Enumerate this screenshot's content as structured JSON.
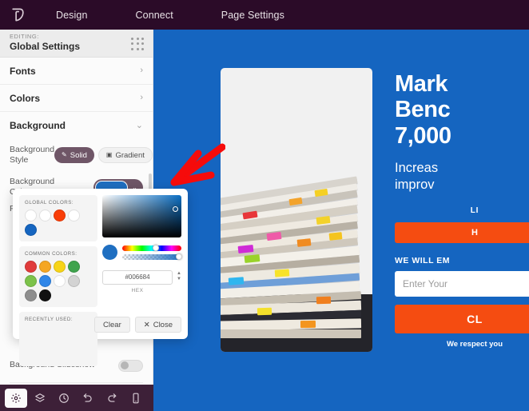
{
  "topbar": {
    "logo_icon": "leaf-logo-icon",
    "nav": [
      {
        "label": "Design",
        "name": "nav-design"
      },
      {
        "label": "Connect",
        "name": "nav-connect"
      },
      {
        "label": "Page Settings",
        "name": "nav-page-settings"
      }
    ],
    "bg_color": "#2b0b28"
  },
  "sidebar": {
    "editing_label": "EDITING:",
    "editing_title": "Global Settings",
    "drag_handle_icon": "grid-dots-icon",
    "sections": [
      {
        "label": "Fonts",
        "name": "section-fonts",
        "chevron": "›"
      },
      {
        "label": "Colors",
        "name": "section-colors",
        "chevron": "›"
      },
      {
        "label": "Background",
        "name": "section-background",
        "chevron": "⌄"
      }
    ],
    "background_style": {
      "label": "Background Style",
      "options": [
        {
          "label": "Solid",
          "icon": "pencil-icon",
          "glyph": "✎",
          "active": true
        },
        {
          "label": "Gradient",
          "icon": "gradient-swatch-icon",
          "glyph": "▣",
          "active": false
        }
      ]
    },
    "background_color": {
      "label": "Background Color",
      "value": "#1f6fc1",
      "caret": "⌄"
    },
    "obscured_row_label": "F",
    "background_slideshow": {
      "label": "Background Slideshow",
      "enabled": false
    }
  },
  "color_picker": {
    "global_colors": {
      "caption": "GLOBAL COLORS:",
      "swatches": [
        "#ffffff",
        "#ffffff",
        "#f93d07",
        "#ffffff",
        "#1565c0"
      ]
    },
    "common_colors": {
      "caption": "COMMON COLORS:",
      "swatches": [
        "#e03b3b",
        "#f5a623",
        "#f7d417",
        "#3fa34d",
        "#7cc24a",
        "#2f86e8",
        "#ffffff",
        "#d3d3d3",
        "#8e8e8e",
        "#111111"
      ]
    },
    "recently_used": {
      "caption": "RECENTLY USED:",
      "swatches": []
    },
    "hex": {
      "value": "#006684",
      "label": "HEX"
    },
    "preview_color": "#1f6fc1",
    "buttons": [
      {
        "label": "Clear",
        "name": "clear-button",
        "icon": null
      },
      {
        "label": "Close",
        "name": "close-button",
        "icon": "x-icon",
        "glyph": "✕"
      }
    ]
  },
  "canvas": {
    "background_color": "#1565c0",
    "image_alt": "stack-of-magazines-with-colored-tabs",
    "hero": {
      "heading_lines": [
        "Mark",
        "Benc",
        "7,000"
      ],
      "subheading_lines": [
        "Increas",
        "improv"
      ],
      "kicker": "LI",
      "button_label": "H",
      "form_label": "WE WILL EM",
      "input_placeholder": "Enter Your",
      "cta_label": "CL",
      "footnote": "We respect you"
    }
  },
  "annotation": {
    "type": "red-arrow",
    "color": "#f60b0b",
    "points_to": "background-color-swatch"
  },
  "bottom_toolbar": {
    "buttons": [
      {
        "name": "settings-gear-icon",
        "label": "Settings",
        "active": true
      },
      {
        "name": "layers-icon",
        "label": "Layers",
        "active": false
      },
      {
        "name": "revision-history-icon",
        "label": "Revision History",
        "active": false
      },
      {
        "name": "undo-icon",
        "label": "Undo",
        "active": false
      },
      {
        "name": "redo-icon",
        "label": "Redo",
        "active": false
      },
      {
        "name": "mobile-preview-icon",
        "label": "Mobile Preview",
        "active": false
      }
    ]
  }
}
